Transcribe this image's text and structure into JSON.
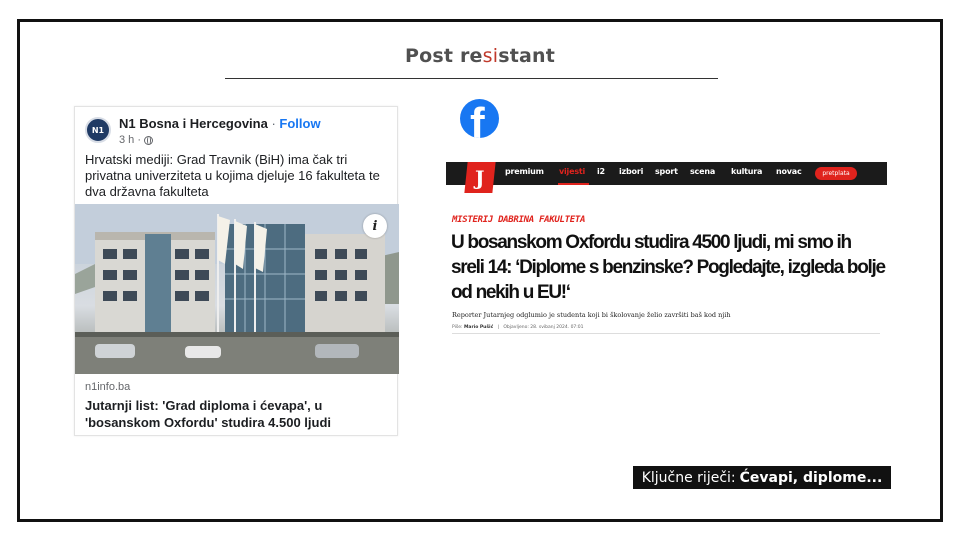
{
  "slide": {
    "title_pre": "Post re",
    "title_mid": "si",
    "title_post": "stant"
  },
  "fb_post": {
    "avatar_text": "N1",
    "page_name": "N1 Bosna i Hercegovina",
    "separator": "·",
    "follow_label": "Follow",
    "time": "3 h ·",
    "text": "Hrvatski mediji: Grad Travnik (BiH) ima čak tri privatna univerziteta u kojima djeluje 16 fakulteta te dva državna fakulteta",
    "info_label": "i",
    "link_domain": "n1info.ba",
    "link_headline": "Jutarnji list: 'Grad diploma i ćevapa', u 'bosanskom Oxfordu' studira 4.500 ljudi"
  },
  "facebook_logo": {
    "glyph": "f"
  },
  "jutarnji": {
    "logo": "J",
    "nav": [
      "premium",
      "vijesti",
      "i2",
      "izbori",
      "sport",
      "scena",
      "kultura",
      "novac"
    ],
    "active_nav": "vijesti",
    "subscribe": "pretplata",
    "kicker": "MISTERIJ DABRINA FAKULTETA",
    "headline": "U bosanskom Oxfordu studira 4500 ljudi, mi smo ih sreli 14: ‘Diplome s benzinske? Pogledajte, izgleda bolje od nekih u EU!‘",
    "lead": "Reporter Jutarnjeg odglumio je studenta koji bi školovanje želio završiti baš kod njih",
    "byline_label": "Piše:",
    "byline_author": "Mario Pušić",
    "published": "Objavljeno: 28. svibanj 2024. 07:01"
  },
  "keywords": {
    "label": "Ključne riječi:",
    "value": "Ćevapi, diplome..."
  },
  "colors": {
    "facebook_blue": "#1877f2",
    "jutarnji_red": "#e0231d",
    "title_grey": "#505050"
  }
}
